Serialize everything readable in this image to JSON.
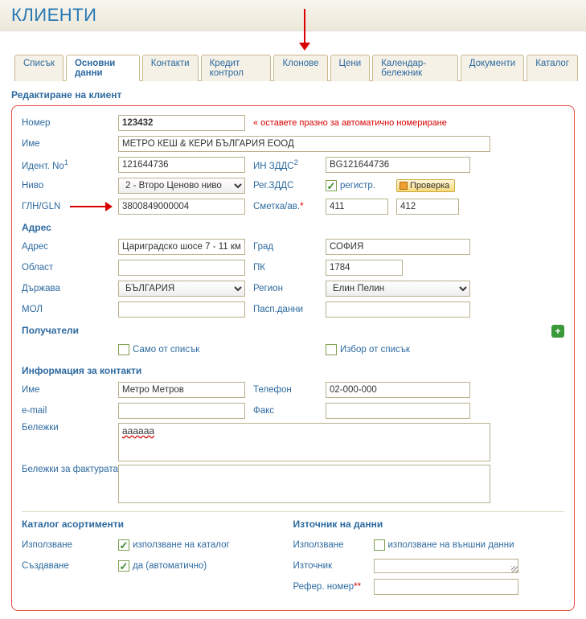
{
  "page_title": "КЛИЕНТИ",
  "tabs": [
    "Списък",
    "Основни данни",
    "Контакти",
    "Кредит контрол",
    "Клонове",
    "Цени",
    "Календар-бележник",
    "Документи",
    "Каталог"
  ],
  "active_tab": 1,
  "form_title": "Редактиране на клиент",
  "labels": {
    "nomer": "Номер",
    "ime": "Име",
    "ident": "Идент. No",
    "nivo": "Ниво",
    "gln": "ГЛН/GLN",
    "in_zdds": "ИН ЗДДС",
    "reg_zdds": "Рег.ЗДДС",
    "smetka": "Сметка/ав.",
    "hint": "« оставете празно за автоматично номериране",
    "registr": "регистр.",
    "proverka": "Проверка",
    "adres_h": "Адрес",
    "adres": "Адрес",
    "grad": "Град",
    "oblast": "Област",
    "pk": "ПК",
    "darzhava": "Държава",
    "region": "Регион",
    "mol": "МОЛ",
    "pasp": "Пасп.данни",
    "poluchateli": "Получатели",
    "samo": "Само от списък",
    "izbor": "Избор от списък",
    "info_h": "Информация за контакти",
    "c_ime": "Име",
    "telefon": "Телефон",
    "email": "e-mail",
    "fax": "Факс",
    "belezhki": "Бележки",
    "belezhki_f": "Бележки за фактурата",
    "katalog_h": "Каталог асортименти",
    "izpolzvane": "Използване",
    "sazdavane": "Създаване",
    "izp_katalog": "използване на каталог",
    "da_auto": "да (автоматично)",
    "iztochnik_h": "Източник на данни",
    "izp_vunshni": "използване на външни данни",
    "iztochnik": "Източник",
    "refer": "Рефер. номер"
  },
  "values": {
    "nomer": "123432",
    "ime": "МЕТРО КЕШ & КЕРИ БЪЛГАРИЯ ЕООД",
    "ident": "121644736",
    "in_zdds": "BG121644736",
    "nivo": "2 - Второ Ценово ниво",
    "gln": "3800849000004",
    "smetka1": "411",
    "smetka2": "412",
    "adres": "Цариградско шосе 7 - 11 км.",
    "grad": "СОФИЯ",
    "oblast": "",
    "pk": "1784",
    "darzhava": "БЪЛГАРИЯ",
    "region": "Елин Пелин",
    "mol": "",
    "pasp": "",
    "c_ime": "Метро Метров",
    "telefon": "02-000-000",
    "email": "",
    "fax": "",
    "belezhki": "aaaaaa",
    "belezhki_f": "",
    "refer": ""
  },
  "checks": {
    "registr": true,
    "samo": false,
    "izbor": false,
    "izp_katalog": true,
    "da_auto": true,
    "izp_vunshni": false
  }
}
